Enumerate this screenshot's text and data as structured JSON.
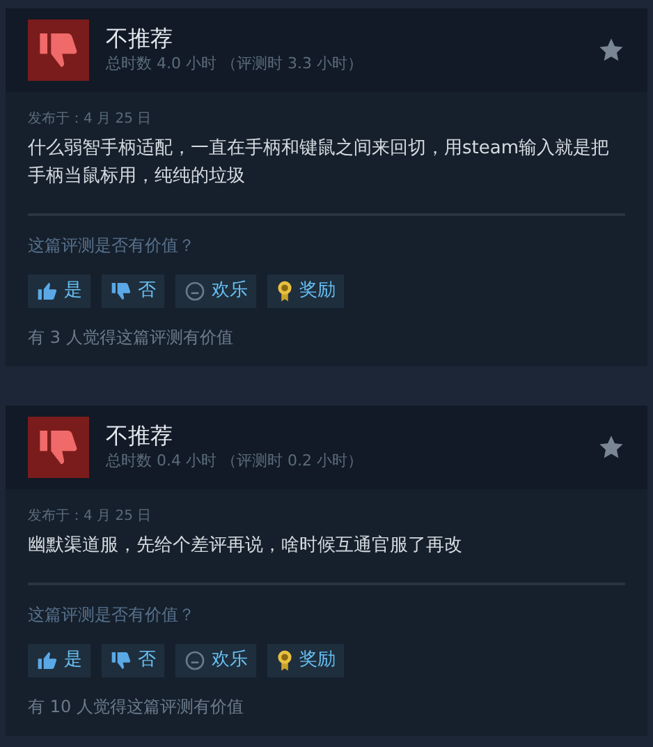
{
  "reviews": [
    {
      "recommended": false,
      "title": "不推荐",
      "hours": "总时数 4.0 小时 （评测时 3.3 小时）",
      "posted": "发布于：4 月 25 日",
      "body": "什么弱智手柄适配，一直在手柄和键鼠之间来回切，用steam输入就是把手柄当鼠标用，纯纯的垃圾",
      "question": "这篇评测是否有价值？",
      "buttons": [
        {
          "kind": "yes",
          "label": "是"
        },
        {
          "kind": "no",
          "label": "否"
        },
        {
          "kind": "funny",
          "label": "欢乐"
        },
        {
          "kind": "award",
          "label": "奖励"
        }
      ],
      "helpful": "有 3 人觉得这篇评测有价值"
    },
    {
      "recommended": false,
      "title": "不推荐",
      "hours": "总时数 0.4 小时 （评测时 0.2 小时）",
      "posted": "发布于：4 月 25 日",
      "body": "幽默渠道服，先给个差评再说，啥时候互通官服了再改",
      "question": "这篇评测是否有价值？",
      "buttons": [
        {
          "kind": "yes",
          "label": "是"
        },
        {
          "kind": "no",
          "label": "否"
        },
        {
          "kind": "funny",
          "label": "欢乐"
        },
        {
          "kind": "award",
          "label": "奖励"
        }
      ],
      "helpful": "有 10 人觉得这篇评测有价值"
    }
  ]
}
